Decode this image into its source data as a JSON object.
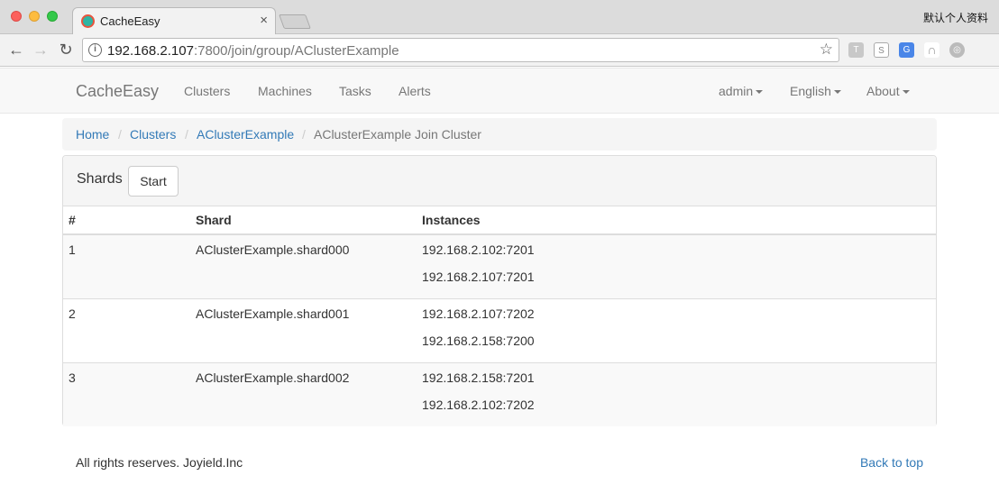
{
  "browser": {
    "tab_title": "CacheEasy",
    "tab_close": "×",
    "profile": "默认个人资料",
    "url_host": "192.168.2.107",
    "url_rest": ":7800/join/group/AClusterExample",
    "back_glyph": "←",
    "forward_glyph": "→",
    "reload_glyph": "↻",
    "star_glyph": "☆",
    "info_glyph": "i",
    "extensions": [
      "T",
      "S",
      "G",
      "∩",
      "◎"
    ]
  },
  "navbar": {
    "brand": "CacheEasy",
    "links": [
      "Clusters",
      "Machines",
      "Tasks",
      "Alerts"
    ],
    "right": [
      "admin",
      "English",
      "About"
    ]
  },
  "breadcrumb": {
    "items": [
      "Home",
      "Clusters",
      "AClusterExample"
    ],
    "separator": "/",
    "active": "AClusterExample Join Cluster"
  },
  "panel": {
    "title": "Shards",
    "start_label": "Start",
    "columns": [
      "#",
      "Shard",
      "Instances"
    ],
    "rows": [
      {
        "index": "1",
        "shard": "AClusterExample.shard000",
        "instances": [
          "192.168.2.102:7201",
          "192.168.2.107:7201"
        ]
      },
      {
        "index": "2",
        "shard": "AClusterExample.shard001",
        "instances": [
          "192.168.2.107:7202",
          "192.168.2.158:7200"
        ]
      },
      {
        "index": "3",
        "shard": "AClusterExample.shard002",
        "instances": [
          "192.168.2.158:7201",
          "192.168.2.102:7202"
        ]
      }
    ]
  },
  "footer": {
    "copyright": "All rights reserves. Joyield.Inc",
    "back_to_top": "Back to top"
  },
  "colors": {
    "link": "#337ab7",
    "navbar_bg": "#f8f8f8",
    "striped_row": "#f9f9f9"
  }
}
